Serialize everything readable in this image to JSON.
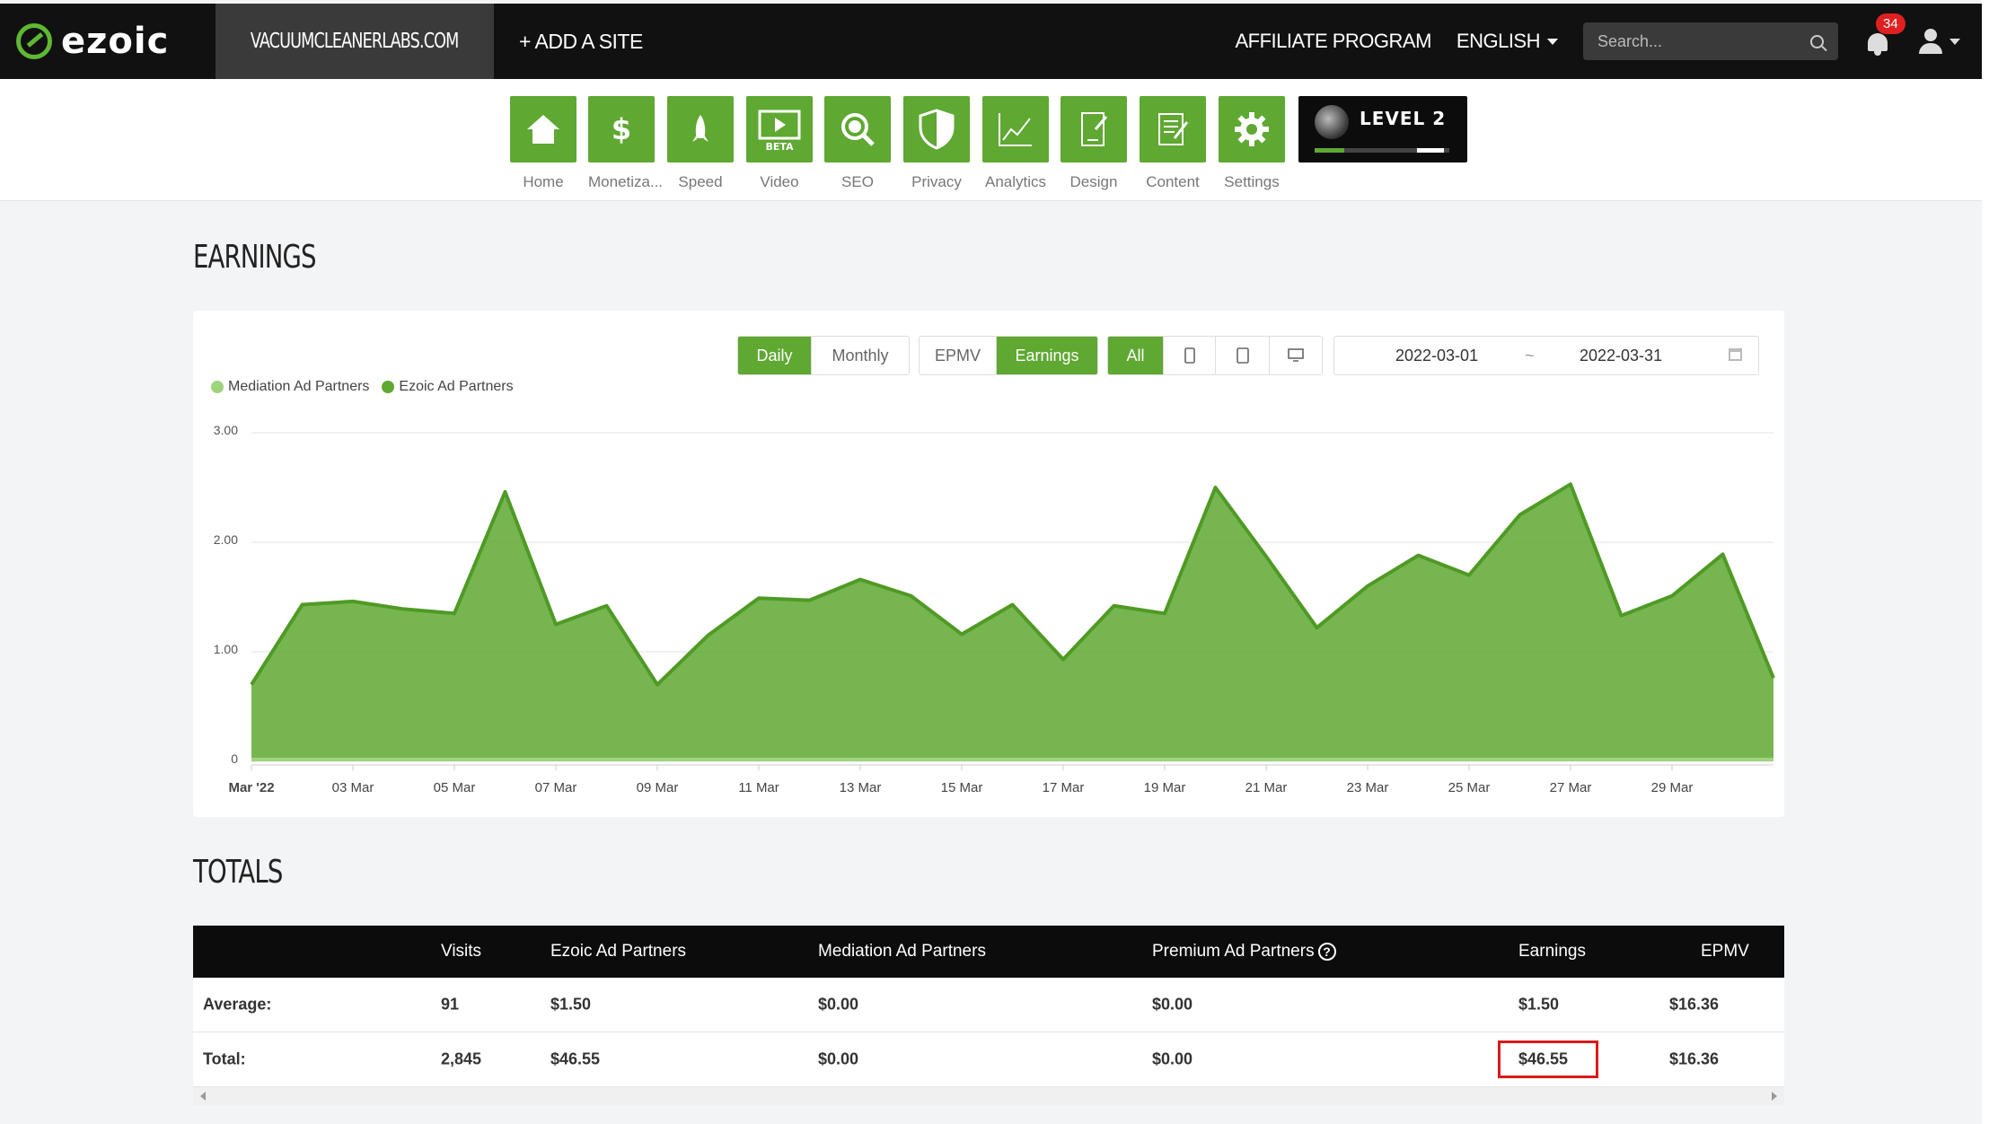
{
  "header": {
    "brand": "ezoic",
    "site": "VACUUMCLEANERLABS.COM",
    "add_site": "+ ADD A SITE",
    "affiliate": "AFFILIATE PROGRAM",
    "language": "ENGLISH",
    "search_placeholder": "Search...",
    "notifications": "34"
  },
  "nav": {
    "items": [
      {
        "label": "Home",
        "icon": "home-icon"
      },
      {
        "label": "Monetiza...",
        "icon": "dollar-icon"
      },
      {
        "label": "Speed",
        "icon": "rocket-icon"
      },
      {
        "label": "Video",
        "icon": "video-icon",
        "badge": "BETA"
      },
      {
        "label": "SEO",
        "icon": "magnifier-icon"
      },
      {
        "label": "Privacy",
        "icon": "shield-icon"
      },
      {
        "label": "Analytics",
        "icon": "line-chart-icon"
      },
      {
        "label": "Design",
        "icon": "design-icon"
      },
      {
        "label": "Content",
        "icon": "content-icon"
      },
      {
        "label": "Settings",
        "icon": "gear-icon"
      }
    ],
    "level": "LEVEL 2",
    "level_progress": 0.22
  },
  "earnings": {
    "title": "EARNINGS",
    "period_buttons": [
      "Daily",
      "Monthly"
    ],
    "metric_buttons": [
      "EPMV",
      "Earnings"
    ],
    "device_buttons": [
      "All"
    ],
    "date_from": "2022-03-01",
    "date_sep": "~",
    "date_to": "2022-03-31",
    "legend": [
      "Mediation Ad Partners",
      "Ezoic Ad Partners"
    ]
  },
  "chart_data": {
    "type": "area",
    "x": [
      "Mar '22",
      "02 Mar",
      "03 Mar",
      "04 Mar",
      "05 Mar",
      "06 Mar",
      "07 Mar",
      "08 Mar",
      "09 Mar",
      "10 Mar",
      "11 Mar",
      "12 Mar",
      "13 Mar",
      "14 Mar",
      "15 Mar",
      "16 Mar",
      "17 Mar",
      "18 Mar",
      "19 Mar",
      "20 Mar",
      "21 Mar",
      "22 Mar",
      "23 Mar",
      "24 Mar",
      "25 Mar",
      "26 Mar",
      "27 Mar",
      "28 Mar",
      "29 Mar",
      "30 Mar",
      "31 Mar"
    ],
    "tick_labels": [
      "Mar '22",
      "03 Mar",
      "05 Mar",
      "07 Mar",
      "09 Mar",
      "11 Mar",
      "13 Mar",
      "15 Mar",
      "17 Mar",
      "19 Mar",
      "21 Mar",
      "23 Mar",
      "25 Mar",
      "27 Mar",
      "29 Mar"
    ],
    "series": [
      {
        "name": "Mediation Ad Partners",
        "color": "#9fd47f",
        "values": [
          0,
          0,
          0,
          0,
          0,
          0,
          0,
          0,
          0,
          0,
          0,
          0,
          0,
          0,
          0,
          0,
          0,
          0,
          0,
          0,
          0,
          0,
          0,
          0,
          0,
          0,
          0,
          0,
          0,
          0,
          0
        ]
      },
      {
        "name": "Ezoic Ad Partners",
        "color": "#5fa832",
        "values": [
          0.7,
          1.43,
          1.46,
          1.39,
          1.35,
          2.46,
          1.25,
          1.42,
          0.7,
          1.15,
          1.49,
          1.47,
          1.66,
          1.51,
          1.16,
          1.43,
          0.93,
          1.42,
          1.35,
          2.5,
          1.87,
          1.22,
          1.6,
          1.88,
          1.7,
          2.25,
          2.53,
          1.33,
          1.51,
          1.89,
          0.76
        ]
      }
    ],
    "yticks": [
      "3.00",
      "2.00",
      "1.00",
      "0"
    ],
    "ylim": [
      0,
      3
    ]
  },
  "totals": {
    "title": "TOTALS",
    "columns": [
      "",
      "Visits",
      "Ezoic Ad Partners",
      "Mediation Ad Partners",
      "Premium Ad Partners",
      "Earnings",
      "EPMV"
    ],
    "rows": [
      {
        "label": "Average:",
        "visits": "91",
        "ezoic": "$1.50",
        "mediation": "$0.00",
        "premium": "$0.00",
        "earnings": "$1.50",
        "epmv": "$16.36"
      },
      {
        "label": "Total:",
        "visits": "2,845",
        "ezoic": "$46.55",
        "mediation": "$0.00",
        "premium": "$0.00",
        "earnings": "$46.55",
        "epmv": "$16.36"
      }
    ]
  },
  "colors": {
    "accent": "#5fa832",
    "dark": "#111111",
    "highlight": "#d91a1a"
  }
}
